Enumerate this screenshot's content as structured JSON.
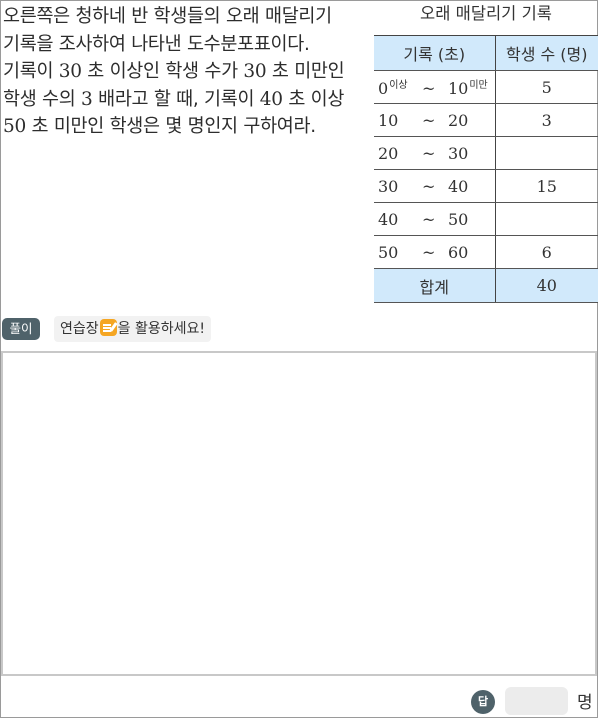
{
  "problem": {
    "segments": [
      {
        "text": "오른쪽은 청하네 반 학생들의 오래 매달리기 기록을 조사하여 나타낸 도수분포표이다. 기록이 ",
        "num": false
      },
      {
        "text": "30",
        "num": true
      },
      {
        "text": " 초 이상인 학생 수가 ",
        "num": false
      },
      {
        "text": "30",
        "num": true
      },
      {
        "text": " 초 미만인 학생 수의 ",
        "num": false
      },
      {
        "text": "3",
        "num": true
      },
      {
        "text": " 배라고 할 때, 기록이 ",
        "num": false
      },
      {
        "text": "40",
        "num": true
      },
      {
        "text": " 초 이상 ",
        "num": false
      },
      {
        "text": "50",
        "num": true
      },
      {
        "text": " 초 미만인 학생은 몇 명인지 구하여라.",
        "num": false
      }
    ]
  },
  "table": {
    "title": "오래 매달리기 기록",
    "col_record": "기록 (초)",
    "col_count": "학생 수 (명)",
    "tilde": "~",
    "above_tag": "이상",
    "below_tag": "미만",
    "rows": [
      {
        "lo": "0",
        "hi": "10",
        "count": "5"
      },
      {
        "lo": "10",
        "hi": "20",
        "count": "3"
      },
      {
        "lo": "20",
        "hi": "30",
        "count": ""
      },
      {
        "lo": "30",
        "hi": "40",
        "count": "15"
      },
      {
        "lo": "40",
        "hi": "50",
        "count": ""
      },
      {
        "lo": "50",
        "hi": "60",
        "count": "6"
      }
    ],
    "total_label": "합계",
    "total_value": "40"
  },
  "solution": {
    "badge": "풀이",
    "hint_before": "연습장",
    "hint_after": "을 활용하세요!",
    "hint_icon": "memo-pencil-icon"
  },
  "answer": {
    "badge": "답",
    "value": "",
    "unit": "명"
  },
  "colors": {
    "table_header_bg": "#d1e9fb",
    "badge_bg": "#4f626a",
    "icon_orange": "#f5a623"
  }
}
